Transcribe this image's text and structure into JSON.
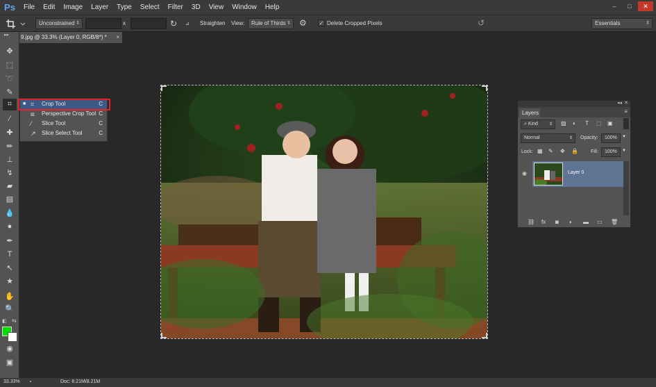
{
  "app": {
    "logo": "Ps",
    "menu": [
      "File",
      "Edit",
      "Image",
      "Layer",
      "Type",
      "Select",
      "Filter",
      "3D",
      "View",
      "Window",
      "Help"
    ]
  },
  "window_controls": {
    "minimize": "–",
    "restore": "□",
    "close": "✕"
  },
  "options": {
    "tool_icon": "crop-icon",
    "ratio_value": "Unconstrained",
    "x_separator": "x",
    "straighten_label": "Straighten",
    "view_label": "View:",
    "view_value": "Rule of Thirds",
    "delete_cropped_label": "Delete Cropped Pixels",
    "delete_cropped_checked": true,
    "workspace_value": "Essentials"
  },
  "document": {
    "tab_title": "9.jpg @ 33.3% (Layer 0, RGB/8*) *",
    "tab_close": "×"
  },
  "toolbar": {
    "fg_color": "#00e000",
    "bg_color": "#ffffff"
  },
  "flyout": {
    "items": [
      {
        "label": "Crop Tool",
        "key": "C",
        "selected": true
      },
      {
        "label": "Perspective Crop Tool",
        "key": "C"
      },
      {
        "label": "Slice Tool",
        "key": "C"
      },
      {
        "label": "Slice Select Tool",
        "key": "C"
      }
    ]
  },
  "layers": {
    "tab_label": "Layers",
    "filter_value": "Kind",
    "blend_value": "Normal",
    "opacity_label": "Opacity:",
    "opacity_value": "100%",
    "lock_label": "Lock:",
    "fill_label": "Fill:",
    "fill_value": "100%",
    "layer_name": "Layer 0"
  },
  "status": {
    "zoom": "33.33%",
    "doc_size": "Doc: 8.21M/8.21M"
  }
}
